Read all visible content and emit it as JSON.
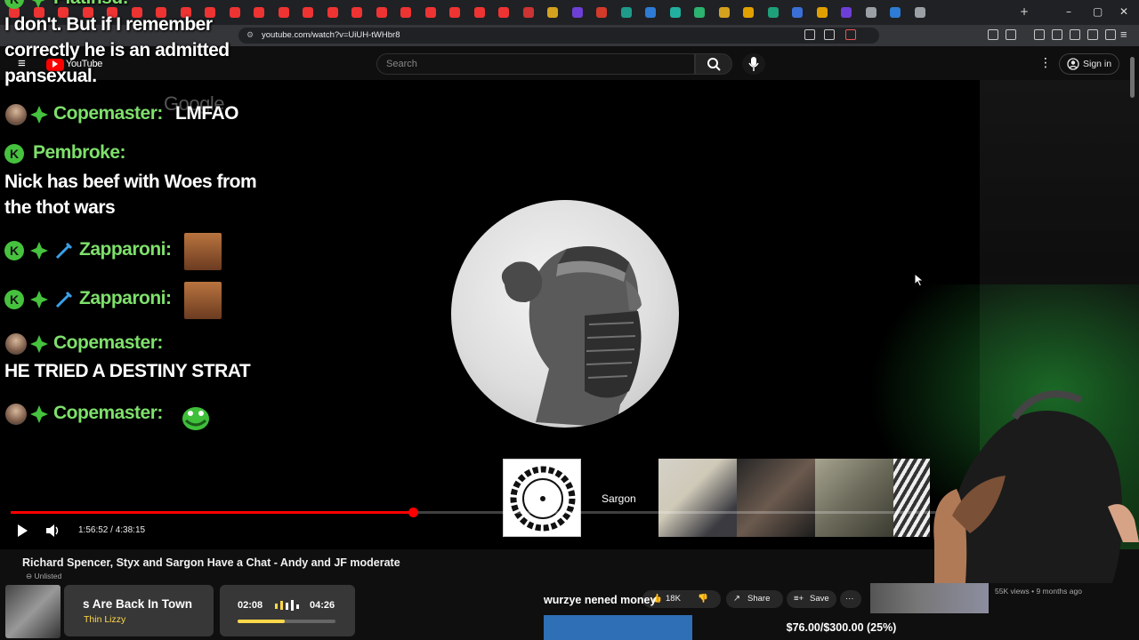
{
  "browser": {
    "url": "youtube.com/watch?v=UiUH-tWHbr8",
    "tab_colors": [
      "#e33",
      "#e33",
      "#e33",
      "#e33",
      "#e33",
      "#e33",
      "#e33",
      "#e33",
      "#e33",
      "#e33",
      "#e33",
      "#e33",
      "#e33",
      "#e33",
      "#e33",
      "#e33",
      "#e33",
      "#e33",
      "#e33",
      "#e33",
      "#e33",
      "#c33",
      "#d5a21f",
      "#6e3fd6",
      "#d23a2a",
      "#1f9a8a",
      "#2d7bd4",
      "#22b0a0",
      "#2bb36f",
      "#d5a21f",
      "#e0a100",
      "#1ea07a",
      "#3a6fd6",
      "#e0a100",
      "#6e3fd6",
      "#9aa0a6",
      "#2d7bd4",
      "#9aa0a6"
    ]
  },
  "youtube": {
    "logo_text": "YouTube",
    "search_placeholder": "Search",
    "signin_label": "Sign in"
  },
  "video": {
    "watermark": "Google",
    "current_time": "1:56:52",
    "duration": "4:38:15",
    "time_display": "1:56:52 / 4:38:15",
    "progress_fraction": 0.42,
    "thumb_label": "Sargon",
    "title": "Richard Spencer, Styx and Sargon Have a Chat - Andy and JF moderate",
    "unlisted": "Unlisted",
    "likes": "18K",
    "share_label": "Share",
    "save_label": "Save",
    "side_views": "55K views • 9 months ago"
  },
  "chat": {
    "top_partial_name": "Platinsd:",
    "msg1_line1": "I don't. But if I remember",
    "msg1_line2": "correctly he is an admitted",
    "msg1_line3": "pansexual.",
    "lines": [
      {
        "name": "Copemaster:",
        "message": "LMFAO"
      },
      {
        "name": "Pembroke:",
        "message": "Nick has beef with Woes from",
        "message2": "the thot wars"
      },
      {
        "name": "Zapparoni:",
        "message": ""
      },
      {
        "name": "Zapparoni:",
        "message": ""
      },
      {
        "name": "Copemaster:",
        "message": "HE TRIED A DESTINY STRAT"
      },
      {
        "name": "Copemaster:",
        "message": ""
      }
    ],
    "badge_k": "K"
  },
  "music": {
    "song_title": "s Are Back In Town",
    "artist": "Thin Lizzy",
    "elapsed": "02:08",
    "total": "04:26",
    "progress_fraction": 0.48
  },
  "stream": {
    "marquee_text": "wurzye nened money",
    "donation_text": "$76.00/$300.00 (25%)",
    "donation_fraction": 0.25
  },
  "colors": {
    "chat_name": "#7ee06b",
    "accent_red": "#ff0000",
    "donation_blue": "#2f6fb6"
  }
}
